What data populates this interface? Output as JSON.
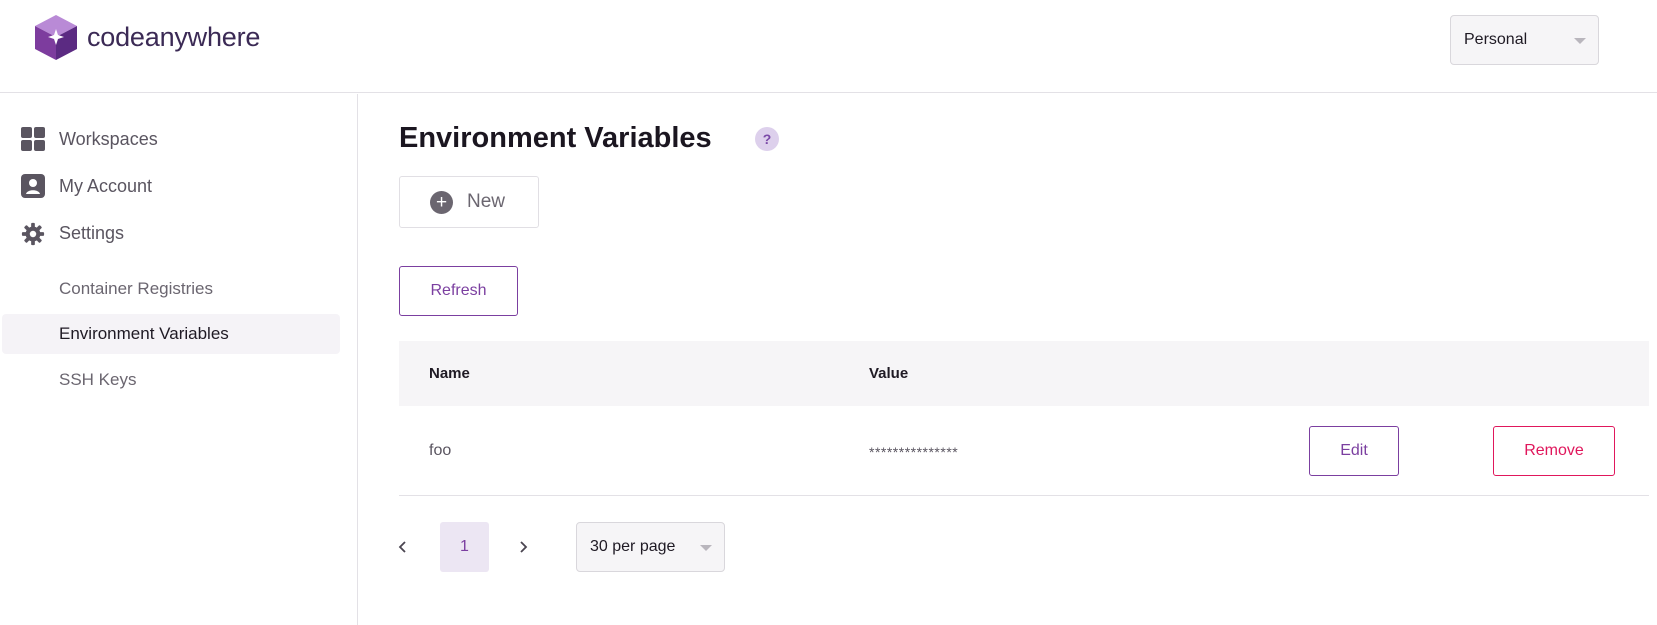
{
  "brand": {
    "name": "codeanywhere"
  },
  "header": {
    "org_select": {
      "value": "Personal"
    }
  },
  "sidebar": {
    "items": [
      {
        "label": "Workspaces",
        "icon": "grid-icon"
      },
      {
        "label": "My Account",
        "icon": "user-icon"
      },
      {
        "label": "Settings",
        "icon": "gear-icon"
      }
    ],
    "sub_items": [
      {
        "label": "Container Registries"
      },
      {
        "label": "Environment Variables",
        "active": true
      },
      {
        "label": "SSH Keys"
      }
    ]
  },
  "main": {
    "title": "Environment Variables",
    "help": "?",
    "new_label": "New",
    "refresh_label": "Refresh",
    "table": {
      "columns": [
        "Name",
        "Value"
      ],
      "rows": [
        {
          "name": "foo",
          "value": "***************",
          "edit_label": "Edit",
          "remove_label": "Remove"
        }
      ]
    },
    "pagination": {
      "current_page": "1",
      "per_page": "30 per page"
    }
  },
  "colors": {
    "accent": "#7b3fa0",
    "danger": "#e0175c",
    "muted": "#6b6670"
  }
}
